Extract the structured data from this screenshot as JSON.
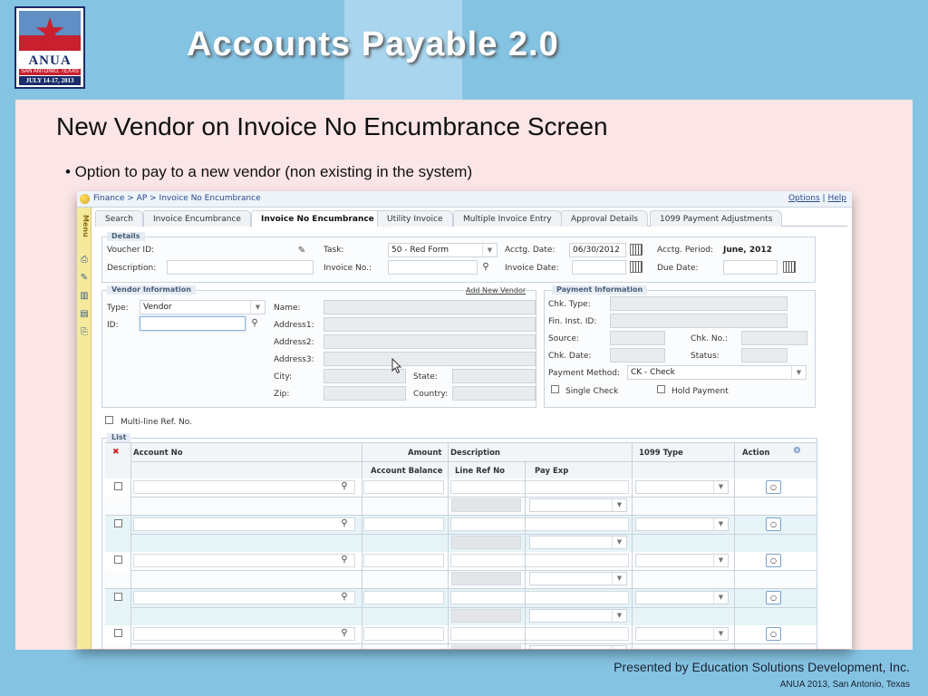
{
  "slide": {
    "title": "Accounts Payable 2.0",
    "subtitle": "New Vendor on Invoice No Encumbrance Screen",
    "bullet": "• Option to pay to a new vendor (non existing in the system)",
    "footer_line1": "Presented by Education Solutions Development, Inc.",
    "footer_line2": "ANUA 2013, San Antonio, Texas",
    "logo": {
      "name": "ANUA",
      "city": "SAN ANTONIO, TEXAS",
      "dates": "JULY 14-17, 2013"
    }
  },
  "app": {
    "breadcrumb": "Finance > AP > Invoice No Encumbrance",
    "options_link": "Options",
    "separator": "|",
    "help_link": "Help",
    "menu_label": "Menu",
    "tabs": [
      "Search",
      "Invoice Encumbrance",
      "Invoice No Encumbrance",
      "Utility Invoice",
      "Multiple Invoice Entry",
      "Approval Details",
      "1099 Payment Adjustments"
    ],
    "details": {
      "legend": "Details",
      "voucher_id_label": "Voucher ID:",
      "task_label": "Task:",
      "task_value": "50 - Red Form",
      "acctg_date_label": "Acctg. Date:",
      "acctg_date_value": "06/30/2012",
      "acctg_period_label": "Acctg. Period:",
      "acctg_period_value": "June, 2012",
      "description_label": "Description:",
      "invoice_no_label": "Invoice No.:",
      "invoice_date_label": "Invoice Date:",
      "due_date_label": "Due Date:"
    },
    "vendor": {
      "legend": "Vendor Information",
      "add_new_vendor": "Add New Vendor",
      "type_label": "Type:",
      "type_value": "Vendor",
      "id_label": "ID:",
      "name_label": "Name:",
      "address1_label": "Address1:",
      "address2_label": "Address2:",
      "address3_label": "Address3:",
      "city_label": "City:",
      "state_label": "State:",
      "zip_label": "Zip:",
      "country_label": "Country:"
    },
    "payment": {
      "legend": "Payment Information",
      "chk_type_label": "Chk. Type:",
      "fin_inst_label": "Fin. Inst. ID:",
      "source_label": "Source:",
      "chk_no_label": "Chk. No.:",
      "chk_date_label": "Chk. Date:",
      "status_label": "Status:",
      "method_label": "Payment Method:",
      "method_value": "CK - Check",
      "single_check_label": "Single Check",
      "hold_payment_label": "Hold Payment"
    },
    "multiline_label": "Multi-line Ref. No.",
    "list": {
      "legend": "List",
      "headers": {
        "account_no": "Account No",
        "amount": "Amount",
        "description": "Description",
        "type_1099": "1099 Type",
        "action": "Action",
        "account_balance": "Account Balance",
        "line_ref_no": "Line Ref No",
        "pay_exp": "Pay Exp"
      },
      "row_count": 5
    }
  }
}
